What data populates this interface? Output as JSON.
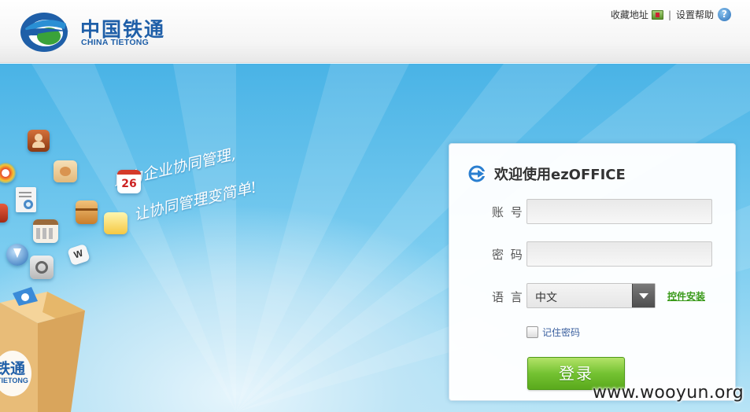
{
  "header": {
    "logo_cn": "中国铁通",
    "logo_en": "CHINA TIETONG",
    "links": {
      "favorite": "收藏地址",
      "separator": "|",
      "help": "设置帮助",
      "help_glyph": "?"
    }
  },
  "banner": {
    "slogan_line1": "助力企业协同管理,",
    "slogan_line2": "让协同管理变简单!",
    "calendar_icon_text": "26",
    "doc_icon_text": "W",
    "box_logo_text": "铁通",
    "box_logo_sub": "TIETONG"
  },
  "login": {
    "title": "欢迎使用ezOFFICE",
    "account_label": "账 号",
    "account_value": "",
    "password_label": "密 码",
    "password_value": "",
    "language_label": "语 言",
    "language_value": "中文",
    "install_link": "控件安装",
    "remember_label": "记住密码",
    "submit_label": "登录"
  },
  "watermark": "www.wooyun.org",
  "colors": {
    "brand_blue": "#1f5fa8",
    "brand_green": "#3a9a1a",
    "submit_green": "#74c232",
    "sky": "#49b3e6"
  }
}
